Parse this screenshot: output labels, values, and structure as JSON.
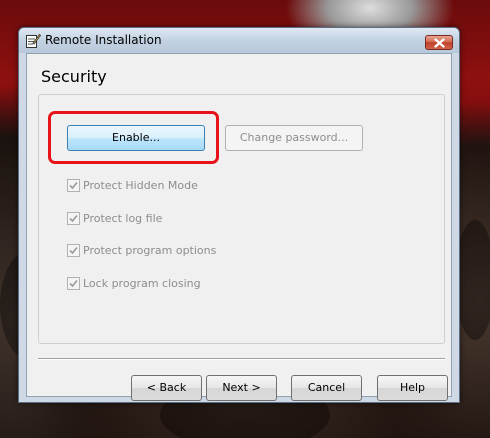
{
  "window": {
    "title": "Remote Installation",
    "close_icon": "close-icon",
    "app_icon": "notepad-pencil-icon"
  },
  "page": {
    "title": "Security"
  },
  "security": {
    "enable_label": "Enable...",
    "change_password_label": "Change password...",
    "options": [
      {
        "label": "Protect Hidden Mode",
        "checked": true,
        "enabled": false
      },
      {
        "label": "Protect log file",
        "checked": true,
        "enabled": false
      },
      {
        "label": "Protect program options",
        "checked": true,
        "enabled": false
      },
      {
        "label": "Lock program closing",
        "checked": true,
        "enabled": false
      }
    ]
  },
  "footer": {
    "back_label": "< Back",
    "next_label": "Next >",
    "cancel_label": "Cancel",
    "help_label": "Help"
  },
  "colors": {
    "highlight": "#e8121a",
    "disabled_text": "#8d8d8d"
  }
}
